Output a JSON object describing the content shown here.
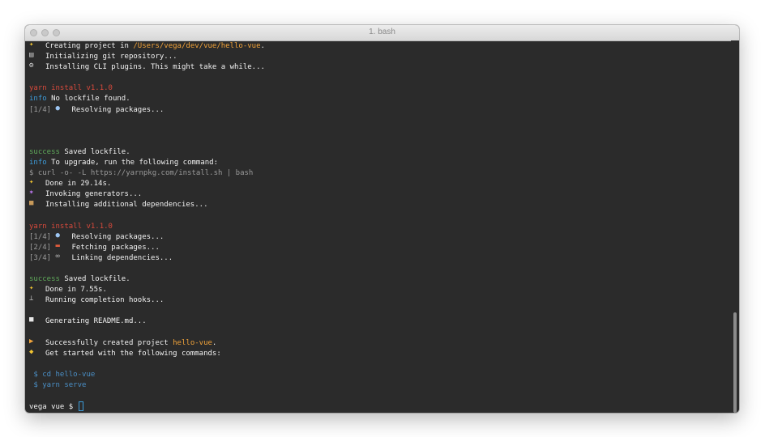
{
  "window": {
    "title": "1. bash"
  },
  "lines": [
    {
      "icon": "sparkles-icon",
      "segs": [
        {
          "t": "Creating project in "
        },
        {
          "t": "/Users/vega/dev/vue/hello-vue",
          "c": "orange"
        },
        {
          "t": "."
        }
      ]
    },
    {
      "icon": "floppy-disk-icon",
      "segs": [
        {
          "t": "Initializing git repository..."
        }
      ]
    },
    {
      "icon": "gear-icon",
      "segs": [
        {
          "t": "Installing CLI plugins. This might take a while..."
        }
      ]
    },
    {
      "segs": []
    },
    {
      "segs": [
        {
          "t": "yarn install v1.1.0",
          "c": "red"
        }
      ]
    },
    {
      "segs": [
        {
          "t": "info",
          "c": "cyan"
        },
        {
          "t": " No lockfile found."
        }
      ]
    },
    {
      "segs": [
        {
          "t": "[1/4] ",
          "c": "gray"
        },
        {
          "icon": "magnifying-glass-icon"
        },
        {
          "t": "Resolving packages..."
        }
      ]
    },
    {
      "segs": []
    },
    {
      "segs": []
    },
    {
      "segs": []
    },
    {
      "segs": [
        {
          "t": "success",
          "c": "green"
        },
        {
          "t": " Saved lockfile."
        }
      ]
    },
    {
      "segs": [
        {
          "t": "info",
          "c": "cyan"
        },
        {
          "t": " To upgrade, run the following command:"
        }
      ]
    },
    {
      "segs": [
        {
          "t": "$ curl -o- -L https://yarnpkg.com/install.sh | bash",
          "c": "gray"
        }
      ]
    },
    {
      "icon": "sparkles-icon",
      "segs": [
        {
          "t": "Done in 29.14s."
        }
      ]
    },
    {
      "icon": "magic-wand-icon",
      "segs": [
        {
          "t": "Invoking generators..."
        }
      ]
    },
    {
      "icon": "package-icon",
      "segs": [
        {
          "t": "Installing additional dependencies..."
        }
      ]
    },
    {
      "segs": []
    },
    {
      "segs": [
        {
          "t": "yarn install v1.1.0",
          "c": "red"
        }
      ]
    },
    {
      "segs": [
        {
          "t": "[1/4] ",
          "c": "gray"
        },
        {
          "icon": "magnifying-glass-icon"
        },
        {
          "t": "Resolving packages..."
        }
      ]
    },
    {
      "segs": [
        {
          "t": "[2/4] ",
          "c": "gray"
        },
        {
          "icon": "truck-icon"
        },
        {
          "t": "Fetching packages..."
        }
      ]
    },
    {
      "segs": [
        {
          "t": "[3/4] ",
          "c": "gray"
        },
        {
          "icon": "link-icon"
        },
        {
          "t": "Linking dependencies..."
        }
      ]
    },
    {
      "segs": []
    },
    {
      "segs": [
        {
          "t": "success",
          "c": "green"
        },
        {
          "t": " Saved lockfile."
        }
      ]
    },
    {
      "icon": "sparkles-icon",
      "segs": [
        {
          "t": "Done in 7.55s."
        }
      ]
    },
    {
      "icon": "anchor-icon",
      "segs": [
        {
          "t": "Running completion hooks..."
        }
      ]
    },
    {
      "segs": []
    },
    {
      "icon": "document-icon",
      "segs": [
        {
          "t": "Generating README.md..."
        }
      ]
    },
    {
      "segs": []
    },
    {
      "icon": "party-popper-icon",
      "segs": [
        {
          "t": "Successfully created project "
        },
        {
          "t": "hello-vue",
          "c": "orange"
        },
        {
          "t": "."
        }
      ]
    },
    {
      "icon": "pointing-hand-icon",
      "segs": [
        {
          "t": "Get started with the following commands:"
        }
      ]
    },
    {
      "segs": []
    },
    {
      "segs": [
        {
          "t": " $ cd hello-vue",
          "c": "blue"
        }
      ]
    },
    {
      "segs": [
        {
          "t": " $ yarn serve",
          "c": "blue"
        }
      ]
    },
    {
      "segs": []
    },
    {
      "segs": [
        {
          "t": "vega vue $ "
        }
      ],
      "cursor": true
    }
  ],
  "colors": {
    "background": "#2b2b2b",
    "text": "#f2f2f2",
    "path": "#f1a33a",
    "error": "#d84a3c",
    "info": "#3d9bd8",
    "success": "#5fa85a",
    "muted": "#9a9a9a",
    "command": "#4a8fc6"
  }
}
